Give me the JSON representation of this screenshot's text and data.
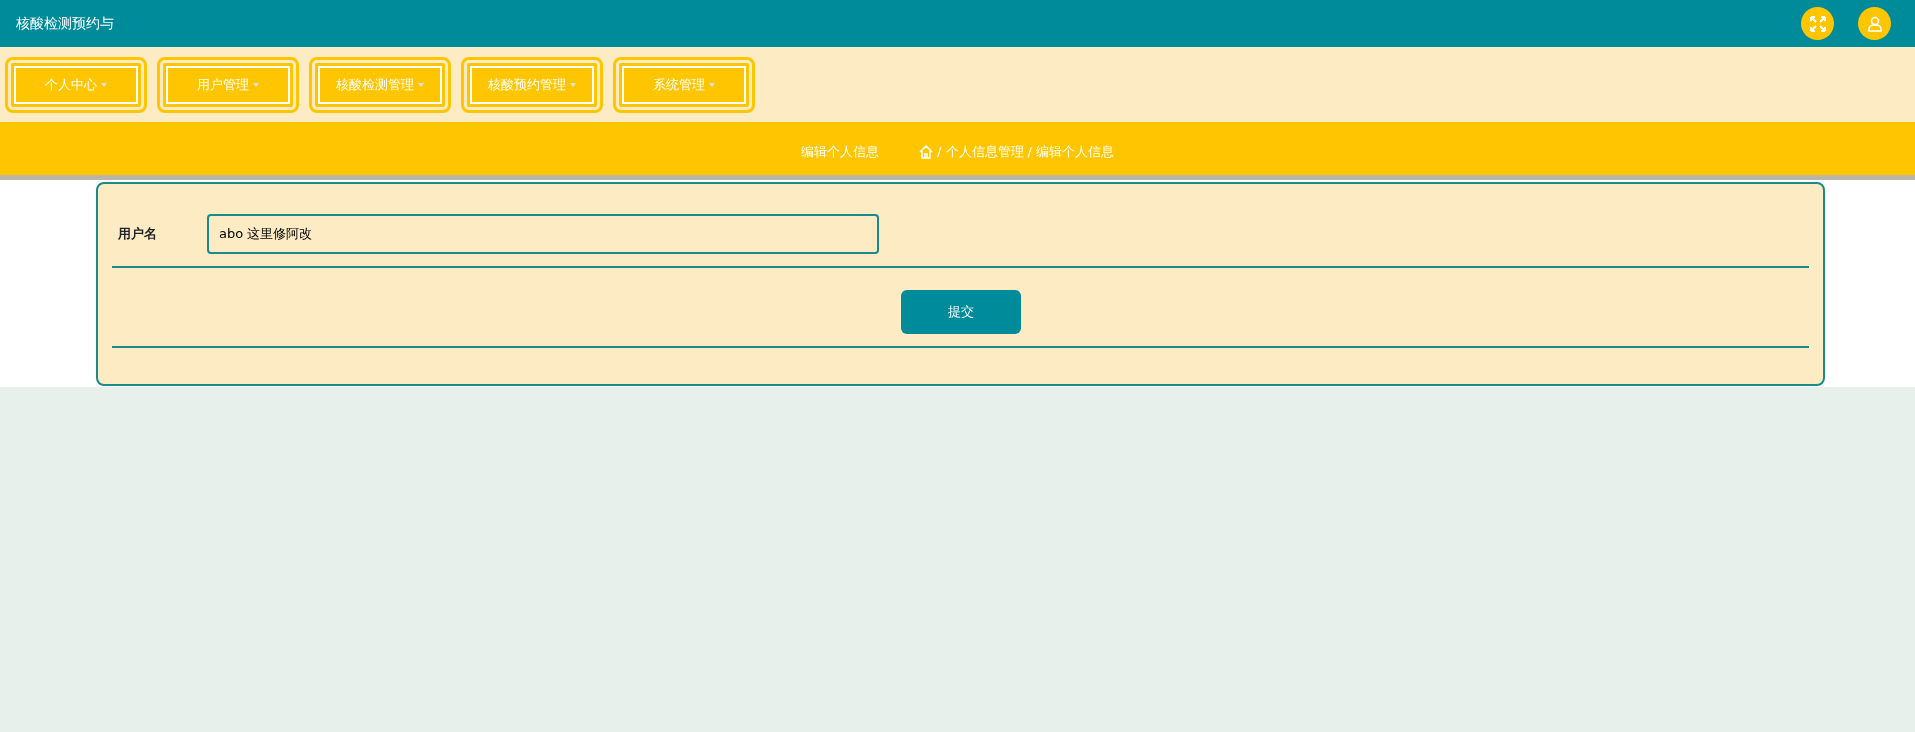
{
  "header": {
    "title": "核酸检测预约与"
  },
  "nav": [
    {
      "label": "个人中心"
    },
    {
      "label": "用户管理"
    },
    {
      "label": "核酸检测管理"
    },
    {
      "label": "核酸预约管理"
    },
    {
      "label": "系统管理"
    }
  ],
  "page_heading": "编辑个人信息",
  "breadcrumb_separator": "/",
  "breadcrumb": [
    "个人信息管理",
    "编辑个人信息"
  ],
  "form": {
    "fields": [
      {
        "label": "用户名",
        "value": "abo 这里修阿改"
      }
    ],
    "submit": "提交"
  }
}
